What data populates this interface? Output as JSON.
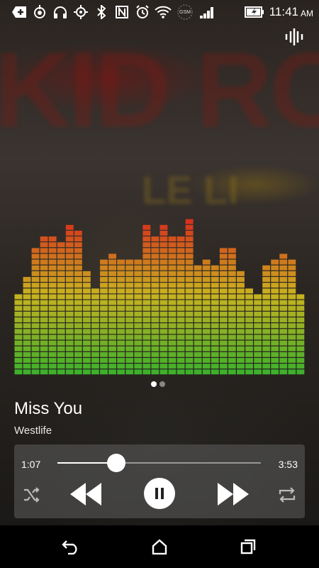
{
  "status_bar": {
    "time": "11:41",
    "ampm": "AM",
    "network_label": "GSM",
    "icons": [
      "add-notification-icon",
      "power-saver-icon",
      "headphones-icon",
      "gps-icon",
      "bluetooth-icon",
      "nfc-icon",
      "alarm-icon",
      "wifi-icon",
      "network-icon",
      "signal-icon",
      "battery-charging-icon"
    ]
  },
  "track": {
    "title": "Miss You",
    "artist": "Westlife"
  },
  "playback": {
    "elapsed": "1:07",
    "duration": "3:53",
    "progress": 0.288,
    "state": "playing"
  },
  "pager": {
    "pages": 2,
    "current": 0
  },
  "equalizer": {
    "levels": [
      14,
      17,
      22,
      24,
      24,
      23,
      26,
      25,
      18,
      15,
      20,
      21,
      20,
      20,
      20,
      26,
      24,
      26,
      24,
      24,
      27,
      19,
      20,
      19,
      22,
      22,
      18,
      15,
      14,
      19,
      20,
      21,
      20,
      14
    ],
    "max_segments": 28,
    "colors": {
      "low": "#3fb02c",
      "mid": "#c9b21e",
      "high": "#d8281c"
    }
  },
  "nav": {
    "icons": [
      "back-icon",
      "home-icon",
      "recents-icon"
    ]
  },
  "colors": {
    "accent": "#ffffff",
    "panel": "#5f5f5f"
  }
}
